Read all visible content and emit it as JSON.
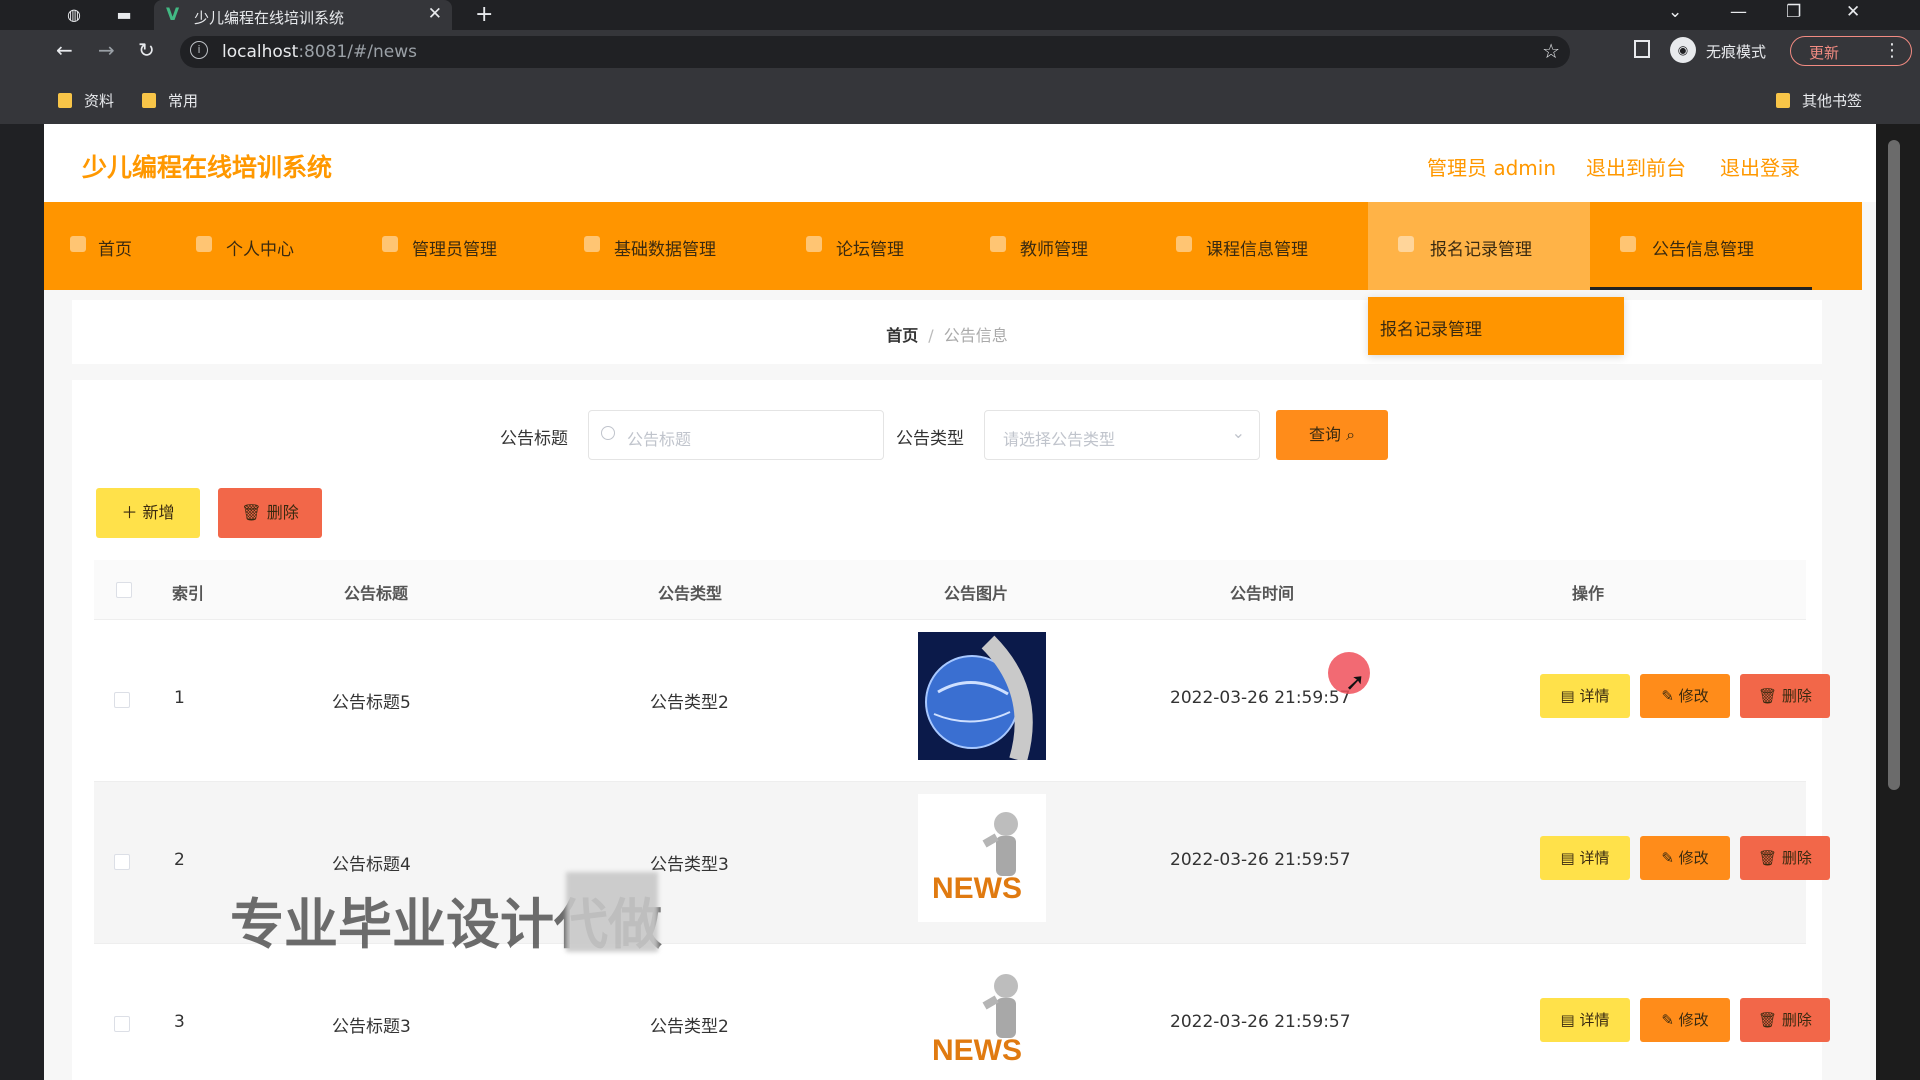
{
  "browser": {
    "tab_title": "少儿编程在线培训系统",
    "url_host": "localhost",
    "url_rest": ":8081/#/news",
    "incognito_label": "无痕模式",
    "update_label": "更新",
    "bookmarks": [
      "资料",
      "常用"
    ],
    "other_bookmarks": "其他书签"
  },
  "header": {
    "logo": "少儿编程在线培训系统",
    "admin": "管理员 admin",
    "to_front": "退出到前台",
    "logout": "退出登录"
  },
  "nav": {
    "items": [
      "首页",
      "个人中心",
      "管理员管理",
      "基础数据管理",
      "论坛管理",
      "教师管理",
      "课程信息管理",
      "报名记录管理",
      "公告信息管理"
    ]
  },
  "dropdown": {
    "item": "报名记录管理"
  },
  "breadcrumb": {
    "home": "首页",
    "sep": "/",
    "current": "公告信息"
  },
  "search": {
    "title_label": "公告标题",
    "title_placeholder": "公告标题",
    "type_label": "公告类型",
    "type_placeholder": "请选择公告类型",
    "query_button": "查询"
  },
  "actions": {
    "add": "＋ 新增",
    "delete": "删除"
  },
  "table": {
    "headers": [
      "索引",
      "公告标题",
      "公告类型",
      "公告图片",
      "公告时间",
      "操作"
    ],
    "rows": [
      {
        "index": "1",
        "title": "公告标题5",
        "type": "公告类型2",
        "time": "2022-03-26 21:59:57",
        "image": "globe-news-image"
      },
      {
        "index": "2",
        "title": "公告标题4",
        "type": "公告类型3",
        "time": "2022-03-26 21:59:57",
        "image": "news-figure-image"
      },
      {
        "index": "3",
        "title": "公告标题3",
        "type": "公告类型2",
        "time": "2022-03-26 21:59:57",
        "image": "news-figure-image"
      }
    ],
    "op_detail": "详情",
    "op_edit": "修改",
    "op_delete": "删除"
  },
  "overlay": {
    "watermark": "专业毕业设计代做"
  },
  "colors": {
    "primary": "#ff9500",
    "logo": "#ff9800",
    "add": "#ffe14a",
    "delete": "#f26749"
  }
}
